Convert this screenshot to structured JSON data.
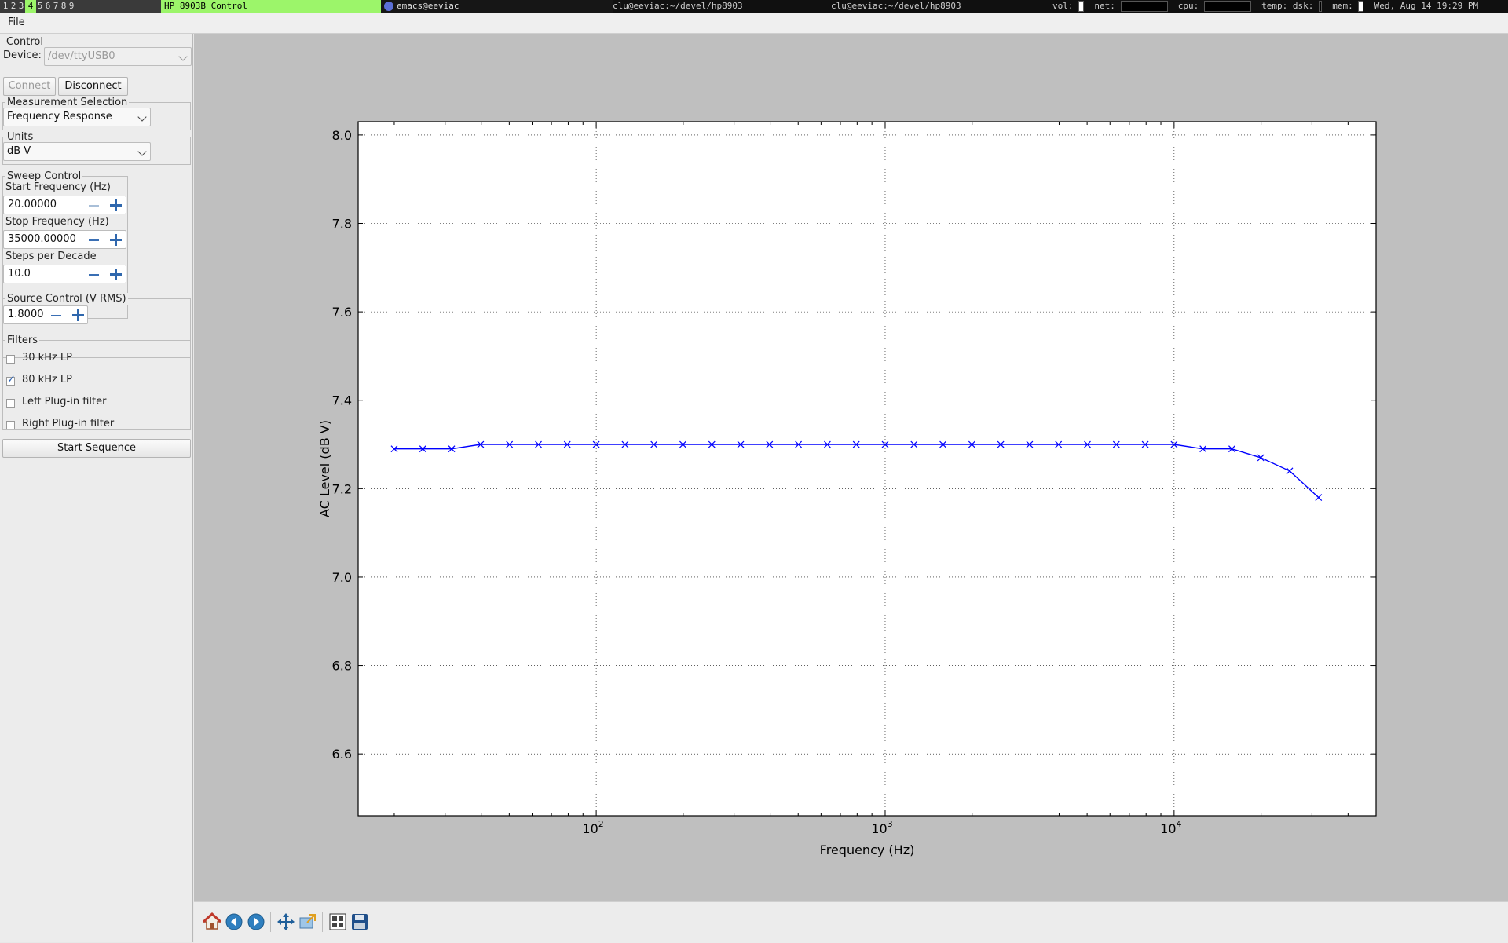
{
  "statusbar": {
    "workspaces": [
      "1",
      "2",
      "3",
      "4",
      "5",
      "6",
      "7",
      "8",
      "9"
    ],
    "active_workspace": "4",
    "active_window_title": "HP 8903B Control",
    "emacs_title": "emacs@eeviac",
    "terminal_1": "clu@eeviac:~/devel/hp8903",
    "terminal_2": "clu@eeviac:~/devel/hp8903",
    "vol_label": "vol:",
    "net_label": "net:",
    "cpu_label": "cpu:",
    "temp_label": "temp:",
    "dsk_label": "dsk:",
    "mem_label": "mem:",
    "datetime": "Wed, Aug 14 19:29 PM"
  },
  "menu": {
    "file": "File"
  },
  "control": {
    "title": "Control",
    "device_label": "Device:",
    "device_value": "/dev/ttyUSB0",
    "connect_label": "Connect",
    "disconnect_label": "Disconnect"
  },
  "measurement": {
    "title": "Measurement Selection",
    "value": "Frequency Response"
  },
  "units": {
    "title": "Units",
    "value": "dB V"
  },
  "sweep": {
    "title": "Sweep Control",
    "start_label": "Start Frequency (Hz)",
    "start_value": "20.00000",
    "stop_label": "Stop Frequency (Hz)",
    "stop_value": "35000.00000",
    "steps_label": "Steps per Decade",
    "steps_value": "10.0"
  },
  "source": {
    "title": "Source Control (V RMS)",
    "value": "1.8000"
  },
  "filters": {
    "title": "Filters",
    "items": [
      {
        "label": "30 kHz LP",
        "checked": false
      },
      {
        "label": "80 kHz LP",
        "checked": true
      },
      {
        "label": "Left Plug-in filter",
        "checked": false
      },
      {
        "label": "Right Plug-in filter",
        "checked": false
      }
    ]
  },
  "start_sequence_label": "Start Sequence",
  "toolbar": {
    "icons": [
      "home-icon",
      "back-icon",
      "forward-icon",
      "pan-icon",
      "zoom-icon",
      "configure-subplots-icon",
      "save-icon"
    ]
  },
  "chart_data": {
    "type": "line",
    "xlabel": "Frequency (Hz)",
    "ylabel": "AC Level (dB V)",
    "xscale": "log",
    "xlim": [
      15,
      50000
    ],
    "ylim": [
      6.46,
      8.03
    ],
    "xticks": [
      100,
      1000,
      10000
    ],
    "xtick_labels": [
      {
        "base": "10",
        "exp": "2"
      },
      {
        "base": "10",
        "exp": "3"
      },
      {
        "base": "10",
        "exp": "4"
      }
    ],
    "yticks": [
      6.6,
      6.8,
      7.0,
      7.2,
      7.4,
      7.6,
      7.8,
      8.0
    ],
    "ytick_labels": [
      "6.6",
      "6.8",
      "7.0",
      "7.2",
      "7.4",
      "7.6",
      "7.8",
      "8.0"
    ],
    "grid": true,
    "marker": "x",
    "color": "#0000ff",
    "x": [
      20,
      25.1,
      31.6,
      39.8,
      50.1,
      63.1,
      79.4,
      100,
      125.9,
      158.5,
      199.5,
      251.2,
      316.2,
      398.1,
      501.2,
      631,
      794.3,
      1000,
      1258.9,
      1584.9,
      1995.3,
      2511.9,
      3162.3,
      3981.1,
      5011.9,
      6309.6,
      7943.3,
      10000,
      12589,
      15849,
      19953,
      25119,
      31623
    ],
    "y": [
      7.29,
      7.29,
      7.29,
      7.3,
      7.3,
      7.3,
      7.3,
      7.3,
      7.3,
      7.3,
      7.3,
      7.3,
      7.3,
      7.3,
      7.3,
      7.3,
      7.3,
      7.3,
      7.3,
      7.3,
      7.3,
      7.3,
      7.3,
      7.3,
      7.3,
      7.3,
      7.3,
      7.3,
      7.29,
      7.29,
      7.27,
      7.24,
      7.18
    ]
  }
}
